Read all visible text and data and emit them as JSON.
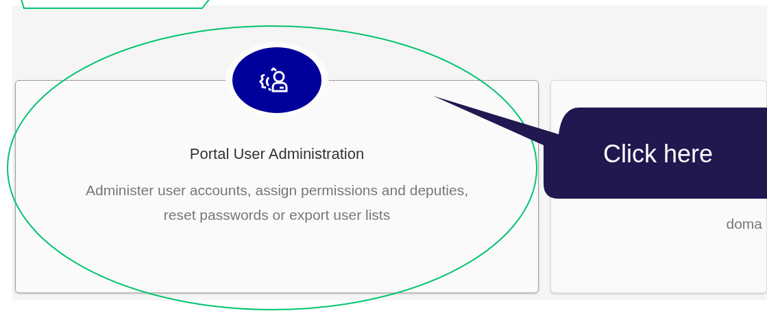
{
  "tiles": [
    {
      "title": "Portal User Administration",
      "description": "Administer user accounts, assign permissions and deputies, reset passwords or export user lists",
      "selected": true
    },
    {
      "description": "doma",
      "selected": false
    }
  ],
  "callout": {
    "text": "Click here"
  }
}
